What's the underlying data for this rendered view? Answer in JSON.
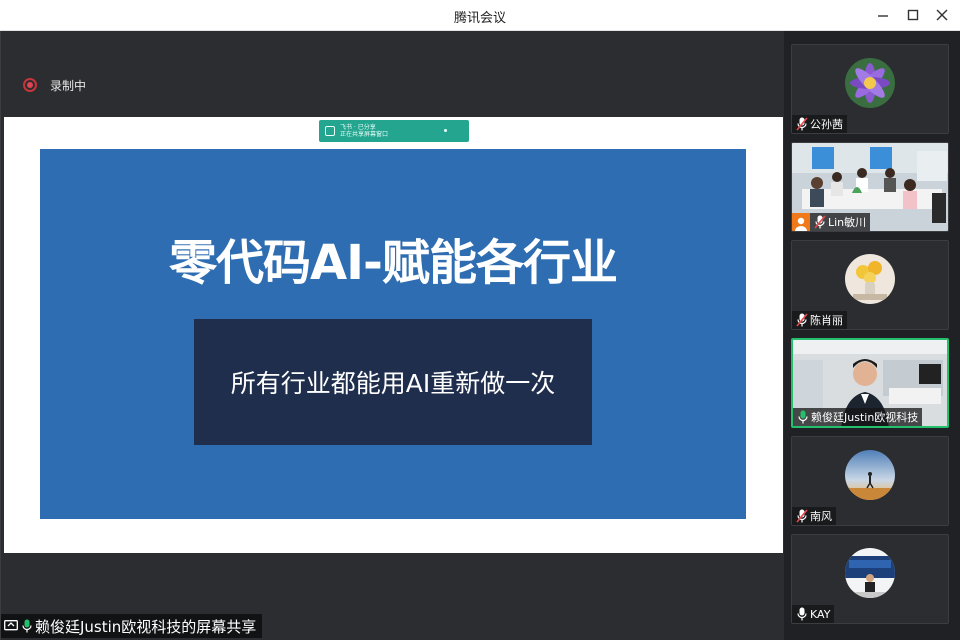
{
  "window": {
    "title": "腾讯会议"
  },
  "recording": {
    "label": "录制中"
  },
  "share": {
    "toast_line1": "飞书 · 已分享",
    "toast_line2": "正在共享屏幕窗口",
    "slide_title": "零代码AI-赋能各行业",
    "slide_subtitle": "所有行业都能用AI重新做一次",
    "presenter_label": "赖俊廷Justin欧视科技的屏幕共享"
  },
  "participants": [
    {
      "name": "公孙茜",
      "mic": "muted",
      "avatar": "purple-flower-avatar"
    },
    {
      "name": "Lin敏川",
      "mic": "muted",
      "avatar": "meeting-room-video"
    },
    {
      "name": "陈肖丽",
      "mic": "muted",
      "avatar": "flowers-vase-avatar"
    },
    {
      "name": "赖俊廷Justin欧视科技",
      "mic": "active",
      "avatar": "speaker-video"
    },
    {
      "name": "南风",
      "mic": "muted",
      "avatar": "sunset-runner-avatar"
    },
    {
      "name": "KAY",
      "mic": "on",
      "avatar": "stage-speaker-avatar"
    }
  ],
  "colors": {
    "slide_bg": "#2e6db1",
    "slide_box": "#1f2e4d",
    "active_speaker_border": "#25c06d",
    "record_red": "#e04450",
    "toast_green": "#23a58f"
  }
}
